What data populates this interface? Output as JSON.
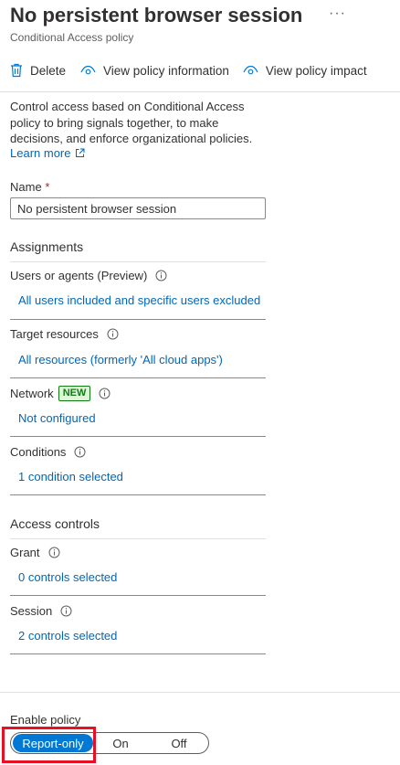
{
  "header": {
    "title": "No persistent browser session",
    "subtitle": "Conditional Access policy",
    "more": "···"
  },
  "toolbar": {
    "delete_label": "Delete",
    "view_info_label": "View policy information",
    "view_impact_label": "View policy impact",
    "icons": [
      "trash-icon",
      "eye-icon",
      "eye-icon"
    ]
  },
  "description": {
    "text": "Control access based on Conditional Access policy to bring signals together, to make decisions, and enforce organizational policies.",
    "learn_more": "Learn more"
  },
  "name_field": {
    "label": "Name",
    "required_mark": "*",
    "value": "No persistent browser session"
  },
  "assignments": {
    "heading": "Assignments",
    "users": {
      "label": "Users or agents (Preview)",
      "value": "All users included and specific users excluded"
    },
    "target": {
      "label": "Target resources",
      "value": "All resources (formerly 'All cloud apps')"
    },
    "network": {
      "label": "Network",
      "badge": "NEW",
      "value": "Not configured"
    },
    "conditions": {
      "label": "Conditions",
      "value": "1 condition selected"
    }
  },
  "access_controls": {
    "heading": "Access controls",
    "grant": {
      "label": "Grant",
      "value": "0 controls selected"
    },
    "session": {
      "label": "Session",
      "value": "2 controls selected"
    }
  },
  "enable_policy": {
    "label": "Enable policy",
    "options": [
      "Report-only",
      "On",
      "Off"
    ],
    "selected": "Report-only"
  },
  "colors": {
    "link": "#0067b8",
    "accent": "#0078d4",
    "required": "#a4262c",
    "new_badge": "#107c10",
    "highlight": "#e81123"
  }
}
